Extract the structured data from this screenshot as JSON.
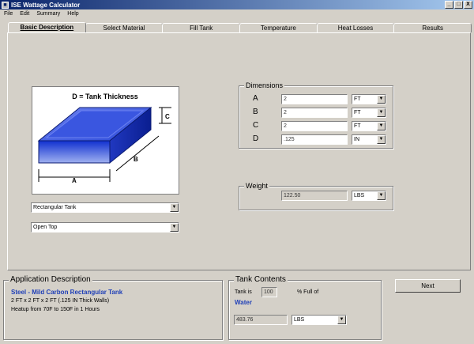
{
  "window": {
    "title": "ISE Wattage Calculator",
    "min": "_",
    "max": "□",
    "close": "X"
  },
  "menu": [
    "File",
    "Edit",
    "Summary",
    "Help"
  ],
  "tabs": [
    "Basic Description",
    "Select Material",
    "Fill Tank",
    "Temperature",
    "Heat Losses",
    "Results"
  ],
  "image": {
    "caption": "D = Tank Thickness",
    "label_a": "A",
    "label_b": "B",
    "label_c": "C"
  },
  "tank_shape": "Rectangular Tank",
  "tank_top": "Open Top",
  "dimensions": {
    "title": "Dimensions",
    "rows": [
      {
        "label": "A",
        "value": "2",
        "unit": "FT"
      },
      {
        "label": "B",
        "value": "2",
        "unit": "FT"
      },
      {
        "label": "C",
        "value": "2",
        "unit": "FT"
      },
      {
        "label": "D",
        "value": ".125",
        "unit": "IN"
      }
    ]
  },
  "weight": {
    "title": "Weight",
    "value": "122.50",
    "unit": "LBS"
  },
  "application": {
    "title": "Application Description",
    "line1": "Steel - Mild Carbon Rectangular Tank",
    "line2": "2 FT x 2  FT x 2 FT (.125 IN Thick Walls)",
    "line3": "Heatup from 70F to 150F in 1 Hours"
  },
  "contents": {
    "title": "Tank Contents",
    "prefix": "Tank is",
    "percent": "100",
    "suffix": "% Full of",
    "liquid": "Water",
    "weight": "483.76",
    "unit": "LBS"
  },
  "next_label": "Next",
  "colors": {
    "title_start": "#0a246a",
    "title_end": "#a6caf0",
    "accent_text": "#1f3fb7",
    "face": "#d4d0c8"
  }
}
